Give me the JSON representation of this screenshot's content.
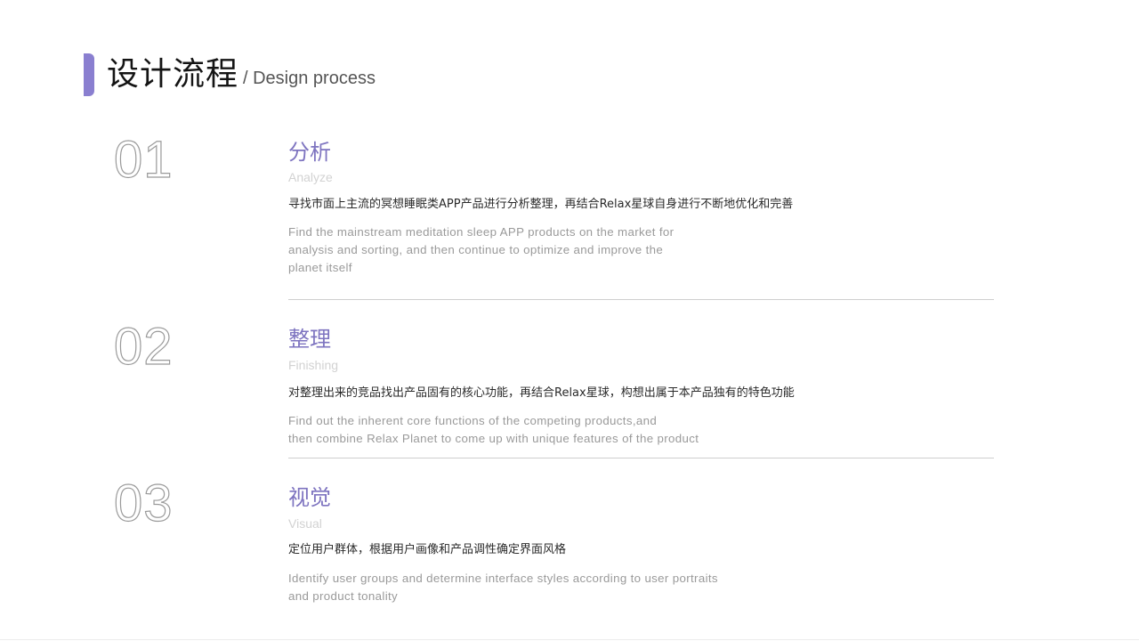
{
  "header": {
    "title_zh": "设计流程",
    "title_en": "/ Design process"
  },
  "colors": {
    "accent": "#8a7fd0",
    "heading": "#7e74c0",
    "number_outline": "#9a9a9a",
    "divider": "#cfcfcf"
  },
  "steps": [
    {
      "number": "01",
      "title_zh": "分析",
      "title_en": "Analyze",
      "desc_zh": "寻找市面上主流的冥想睡眠类APP产品进行分析整理，再结合Relax星球自身进行不断地优化和完善",
      "desc_en_lines": [
        "Find the mainstream meditation sleep APP products on the market for",
        "analysis and sorting, and then continue to optimize and improve the",
        "planet itself"
      ]
    },
    {
      "number": "02",
      "title_zh": "整理",
      "title_en": "Finishing",
      "desc_zh": "对整理出来的竞品找出产品固有的核心功能，再结合Relax星球，构想出属于本产品独有的特色功能",
      "desc_en_lines": [
        "Find out the inherent core functions of the competing products,and",
        "then combine Relax Planet to come up with unique features of the product"
      ]
    },
    {
      "number": "03",
      "title_zh": "视觉",
      "title_en": "Visual",
      "desc_zh": "定位用户群体，根据用户画像和产品调性确定界面风格",
      "desc_en_lines": [
        "Identify user groups and determine interface styles according to user portraits",
        "and product tonality"
      ]
    }
  ]
}
